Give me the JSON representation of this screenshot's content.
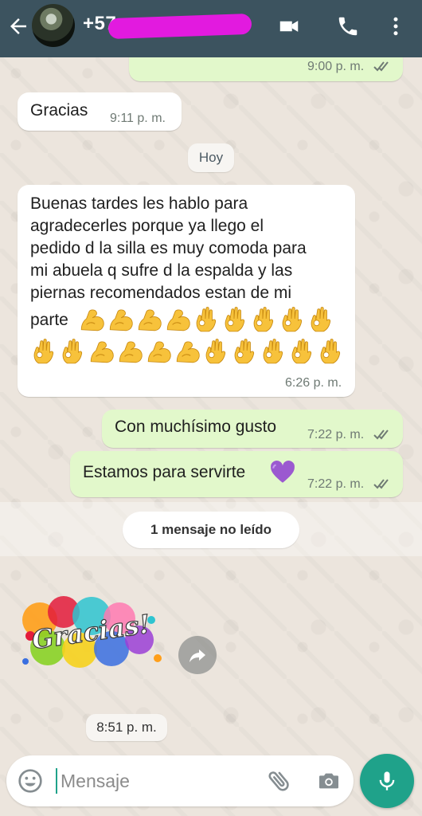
{
  "header": {
    "contact_name": "+57",
    "icons": [
      "back-arrow-icon",
      "video-call-icon",
      "phone-icon",
      "more-vert-icon"
    ]
  },
  "messages": [
    {
      "id": "m0",
      "direction": "outgoing",
      "text": "",
      "time": "9:00 p. m.",
      "status": "read"
    },
    {
      "id": "m1",
      "direction": "incoming",
      "text": "Gracias",
      "time": "9:11 p. m."
    },
    {
      "id": "m2",
      "direction": "incoming",
      "lines": [
        "Buenas tardes les hablo para",
        "agradecerles porque ya llego el",
        "pedido d la silla es muy comoda para",
        "mi abuela q sufre d la espalda y las",
        "piernas recomendados estan de mi",
        "parte"
      ],
      "emoji_row1": [
        "flexed-biceps",
        "flexed-biceps",
        "flexed-biceps",
        "flexed-biceps",
        "ok-hand",
        "ok-hand",
        "ok-hand",
        "ok-hand",
        "ok-hand"
      ],
      "emoji_row2": [
        "ok-hand",
        "ok-hand",
        "flexed-biceps",
        "flexed-biceps",
        "flexed-biceps",
        "flexed-biceps",
        "ok-hand",
        "ok-hand",
        "ok-hand",
        "ok-hand",
        "ok-hand"
      ],
      "time": "6:26 p. m."
    },
    {
      "id": "m3",
      "direction": "outgoing",
      "text": "Con muchísimo gusto",
      "time": "7:22 p. m.",
      "status": "read"
    },
    {
      "id": "m4",
      "direction": "outgoing",
      "text": "Estamos para servirte",
      "emoji": "purple-heart",
      "time": "7:22 p. m.",
      "status": "read"
    },
    {
      "id": "m5",
      "direction": "incoming",
      "type": "sticker",
      "sticker_text": "Gracias!",
      "time": "8:51 p. m."
    }
  ],
  "date_separator": "Hoy",
  "unread_separator": "1 mensaje no leído",
  "composer": {
    "placeholder": "Mensaje"
  },
  "colors": {
    "header": "#3c535f",
    "outgoing_bubble": "#e2f8cb",
    "incoming_bubble": "#ffffff",
    "accent": "#1fa28a",
    "redaction": "#e21adf"
  }
}
